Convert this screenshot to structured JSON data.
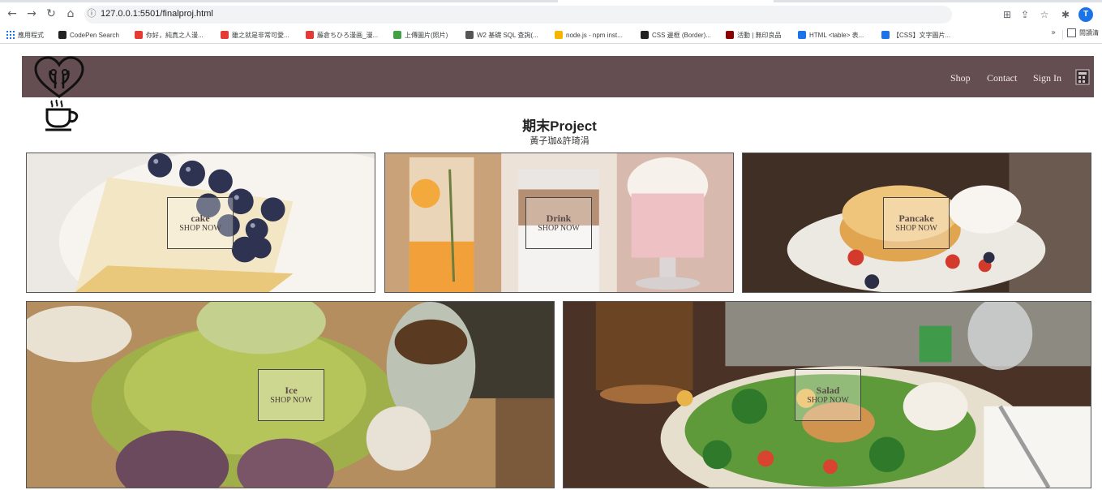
{
  "browser": {
    "url": "127.0.0.1:5501/finalproj.html",
    "profile_initial": "T",
    "bookmarks": [
      {
        "label": "應用程式",
        "color": "#1a73e8"
      },
      {
        "label": "CodePen Search",
        "color": "#222222"
      },
      {
        "label": "你好，純真之人漫...",
        "color": "#e53935"
      },
      {
        "label": "雖之就是非常可愛...",
        "color": "#e53935"
      },
      {
        "label": "藤倉ちひろ漫画_漫...",
        "color": "#e53935"
      },
      {
        "label": "上傳圖片(照片)",
        "color": "#43a047"
      },
      {
        "label": "W2 基礎 SQL 查詢(...",
        "color": "#555555"
      },
      {
        "label": "node.js - npm inst...",
        "color": "#f4b400"
      },
      {
        "label": "CSS 邊框 (Border)...",
        "color": "#222222"
      },
      {
        "label": "活動 | 無印良品",
        "color": "#8b0000"
      },
      {
        "label": "HTML <table> 表...",
        "color": "#1a73e8"
      },
      {
        "label": "【CSS】文字圖片...",
        "color": "#1a73e8"
      }
    ],
    "more_label": "»",
    "reading_list_label": "閱讀清"
  },
  "page": {
    "title": "期末Project",
    "subtitle": "黃子珈&許琦涓",
    "nav": {
      "shop": "Shop",
      "contact": "Contact",
      "signin": "Sign In"
    }
  },
  "categories": [
    {
      "name": "cake",
      "cta": "SHOP NOW"
    },
    {
      "name": "Drink",
      "cta": "SHOP NOW"
    },
    {
      "name": "Pancake",
      "cta": "SHOP NOW"
    },
    {
      "name": "Ice",
      "cta": "SHOP NOW"
    },
    {
      "name": "Salad",
      "cta": "SHOP NOW"
    }
  ],
  "colors": {
    "navbar": "#644e51",
    "nav_text": "#f0e8e8"
  },
  "icons": [
    "back-icon",
    "forward-icon",
    "reload-icon",
    "home-icon",
    "info-icon",
    "translate-icon",
    "share-icon",
    "star-icon",
    "extensions-icon",
    "cart-icon",
    "heart-logo-icon",
    "coffee-cup-icon"
  ]
}
